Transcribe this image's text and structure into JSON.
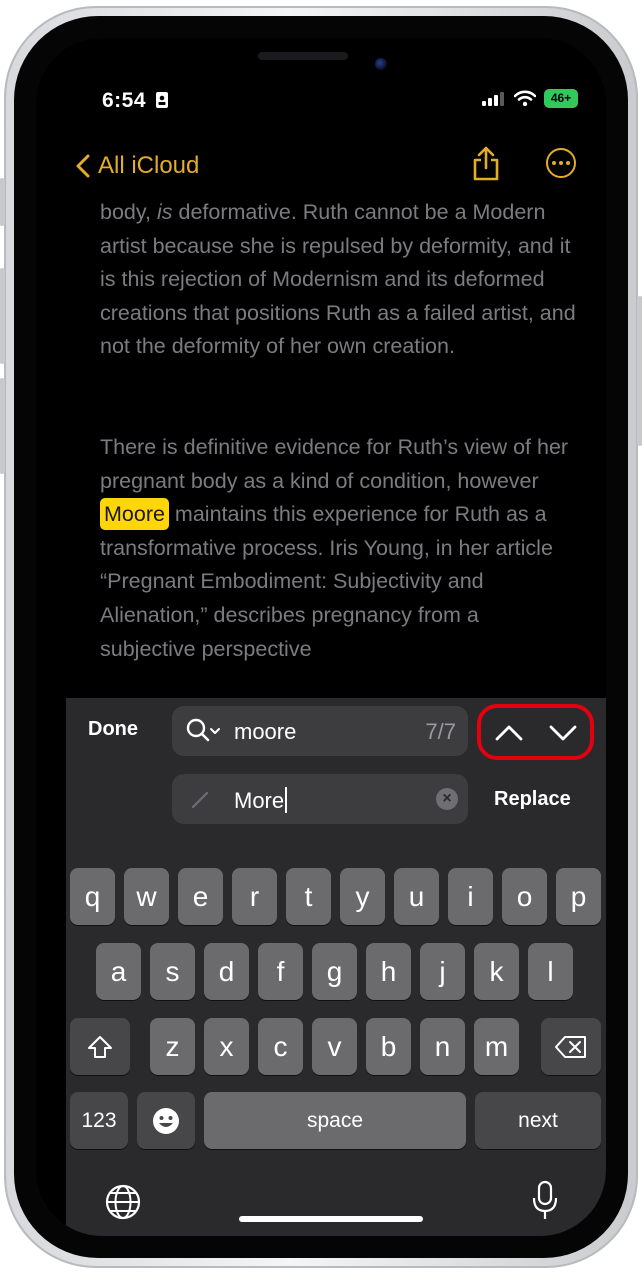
{
  "status": {
    "time": "6:54",
    "battery": "46+"
  },
  "nav": {
    "back_label": "All iCloud"
  },
  "note": {
    "paragraph1_pre": "body, ",
    "paragraph1_italic": "is",
    "paragraph1_rest": " deformative. Ruth cannot be a Modern artist because she is repulsed by deformity, and it is this rejection of Modernism and its deformed creations that positions Ruth as a failed artist, and not the deformity of her own creation.",
    "paragraph2_pre": "There is definitive evidence for Ruth’s view of her pregnant body as a kind of condition, however ",
    "paragraph2_highlight": "Moore",
    "paragraph2_post": " maintains this experience for Ruth as a transformative process. Iris Young, in her article “Pregnant Embodiment: Subjectivity and Alienation,” describes pregnancy from a subjective perspective"
  },
  "find": {
    "done_label": "Done",
    "search_value": "moore",
    "match_count": "7/7",
    "replace_value": "More",
    "replace_label": "Replace"
  },
  "keyboard": {
    "row1": [
      "q",
      "w",
      "e",
      "r",
      "t",
      "y",
      "u",
      "i",
      "o",
      "p"
    ],
    "row2": [
      "a",
      "s",
      "d",
      "f",
      "g",
      "h",
      "j",
      "k",
      "l"
    ],
    "row3": [
      "z",
      "x",
      "c",
      "v",
      "b",
      "n",
      "m"
    ],
    "numbers_label": "123",
    "space_label": "space",
    "next_label": "next"
  }
}
